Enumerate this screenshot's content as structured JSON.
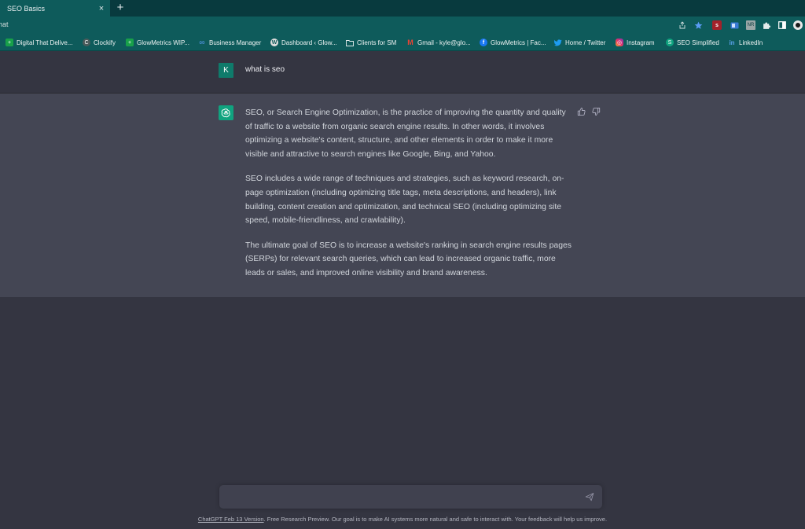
{
  "browser": {
    "tab": {
      "title": "SEO Basics",
      "close": "×"
    },
    "new_tab": "+",
    "url_fragment": "hat",
    "extensions": {
      "red_badge": "s",
      "nr_badge": "NR"
    },
    "bookmarks": [
      {
        "label": "Digital That Delive...",
        "icon": "green-plus-icon",
        "color": "#18a04a",
        "glyph": "+"
      },
      {
        "label": "Clockify",
        "icon": "clockify-icon",
        "color": "#4a5a5a",
        "glyph": "C"
      },
      {
        "label": "GlowMetrics WIP...",
        "icon": "green-plus-icon",
        "color": "#18a04a",
        "glyph": "+"
      },
      {
        "label": "Business Manager",
        "icon": "meta-icon",
        "color": "#1b6ef3",
        "glyph": "∞"
      },
      {
        "label": "Dashboard ‹ Glow...",
        "icon": "wordpress-icon",
        "color": "#dddddd",
        "glyph": "W"
      },
      {
        "label": "Clients for SM",
        "icon": "folder-icon",
        "color": "#0e5b5b",
        "glyph": "▭"
      },
      {
        "label": "Gmail - kyle@glo...",
        "icon": "gmail-icon",
        "color": "#ea4335",
        "glyph": "M"
      },
      {
        "label": "GlowMetrics | Fac...",
        "icon": "facebook-icon",
        "color": "#1877f2",
        "glyph": "f"
      },
      {
        "label": "Home / Twitter",
        "icon": "twitter-icon",
        "color": "#1d9bf0",
        "glyph": "t"
      },
      {
        "label": "Instagram",
        "icon": "instagram-icon",
        "color": "#e1306c",
        "glyph": "◎"
      },
      {
        "label": "SEO Simplified",
        "icon": "seo-simplified-icon",
        "color": "#10a37f",
        "glyph": "S"
      },
      {
        "label": "LinkedIn",
        "icon": "linkedin-icon",
        "color": "#0a66c2",
        "glyph": "in"
      }
    ]
  },
  "chat": {
    "user": {
      "avatar_letter": "K",
      "message": "what is seo"
    },
    "assistant": {
      "paragraphs": [
        "SEO, or Search Engine Optimization, is the practice of improving the quantity and quality of traffic to a website from organic search engine results. In other words, it involves optimizing a website's content, structure, and other elements in order to make it more visible and attractive to search engines like Google, Bing, and Yahoo.",
        "SEO includes a wide range of techniques and strategies, such as keyword research, on-page optimization (including optimizing title tags, meta descriptions, and headers), link building, content creation and optimization, and technical SEO (including optimizing site speed, mobile-friendliness, and crawlability).",
        "The ultimate goal of SEO is to increase a website's ranking in search engine results pages (SERPs) for relevant search queries, which can lead to increased organic traffic, more leads or sales, and improved online visibility and brand awareness."
      ]
    },
    "input": {
      "value": "",
      "placeholder": ""
    }
  },
  "footer": {
    "version_link": "ChatGPT Feb 13 Version",
    "text": ". Free Research Preview. Our goal is to make AI systems more natural and safe to interact with. Your feedback will help us improve."
  },
  "colors": {
    "accent": "#10a37f",
    "user_avatar": "#0f7b6b",
    "browser_frame": "#0e5b5b",
    "chat_bg": "#343541",
    "assistant_bg": "#444654"
  }
}
